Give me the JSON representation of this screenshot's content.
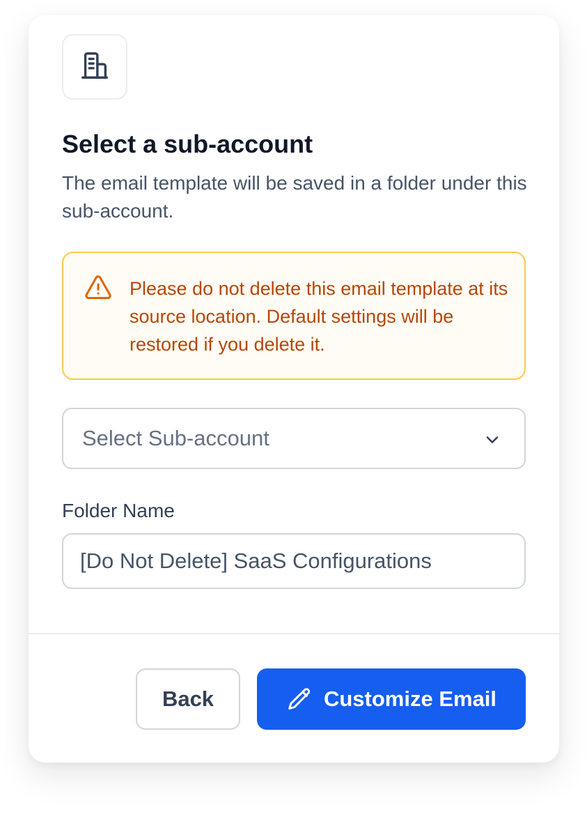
{
  "dialog": {
    "header_icon": "building-icon",
    "title": "Select a sub-account",
    "subtitle": "The email template will be saved in a folder under this sub-account."
  },
  "warning": {
    "icon": "warning-triangle-icon",
    "message": "Please do not delete this email template at its source location. Default settings will be restored if you delete it."
  },
  "subaccount_select": {
    "selected_value": "Select Sub-account",
    "icon": "chevron-down-icon"
  },
  "folder_name": {
    "label": "Folder Name",
    "value": "[Do Not Delete] SaaS Configurations"
  },
  "footer": {
    "back_label": "Back",
    "primary_label": "Customize Email",
    "primary_icon": "pencil-icon"
  },
  "colors": {
    "primary": "#155eef",
    "warning_text": "#b54708",
    "warning_border": "#fec84b",
    "warning_bg": "#fffcf5"
  }
}
